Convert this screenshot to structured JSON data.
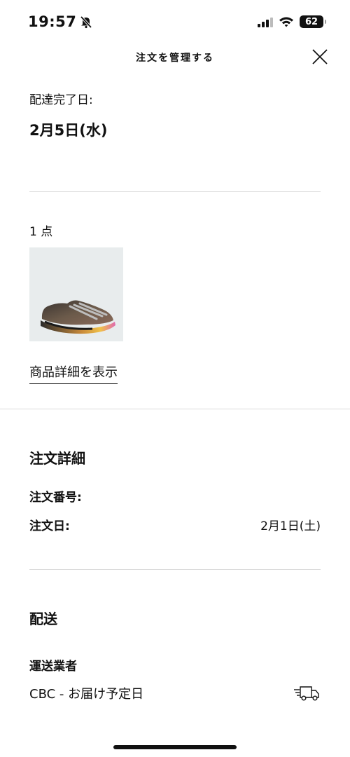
{
  "status_bar": {
    "time": "19:57",
    "battery": "62"
  },
  "header": {
    "title": "注文を管理する"
  },
  "delivery": {
    "label": "配達完了日:",
    "date": "2月5日(水)"
  },
  "items": {
    "count_label": "1 点",
    "details_link": "商品詳細を表示"
  },
  "order_details": {
    "heading": "注文詳細",
    "order_number_label": "注文番号:",
    "order_date_label": "注文日:",
    "order_date_value": "2月1日(土)"
  },
  "shipping": {
    "heading": "配送",
    "carrier_label": "運送業者",
    "carrier_value": "CBC - お届け予定日"
  }
}
